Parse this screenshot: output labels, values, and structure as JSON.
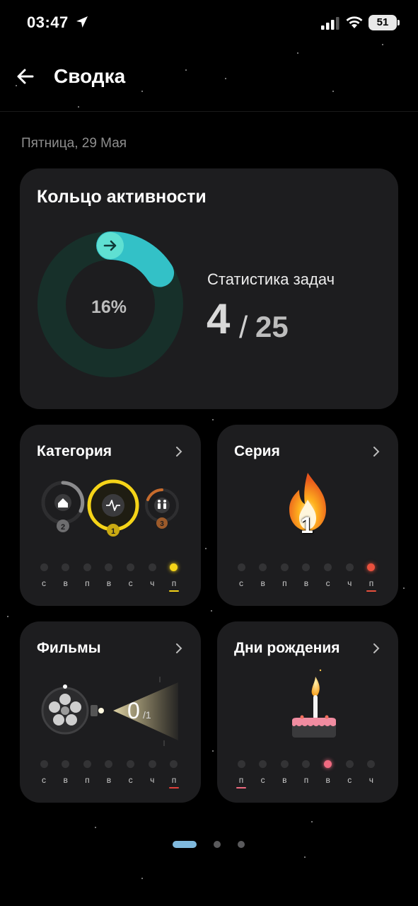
{
  "status_bar": {
    "time": "03:47",
    "battery": "51"
  },
  "header": {
    "title": "Сводка"
  },
  "date": "Пятница, 29 Мая",
  "activity": {
    "title": "Кольцо активности",
    "percent_label": "16%",
    "progress": 0.16,
    "stats_label": "Статистика задач",
    "done": "4",
    "slash": "/",
    "total": "25"
  },
  "categories": {
    "title": "Категория",
    "icons": [
      "home-icon",
      "pulse-icon",
      "family-icon"
    ],
    "ranks": [
      "2",
      "1",
      "3"
    ],
    "days": [
      "с",
      "в",
      "п",
      "в",
      "с",
      "ч",
      "п"
    ],
    "active_index": 6,
    "accent": "#f5d418"
  },
  "streak": {
    "title": "Серия",
    "count": "1",
    "days": [
      "с",
      "в",
      "п",
      "в",
      "с",
      "ч",
      "п"
    ],
    "active_index": 6,
    "accent": "#e8503d"
  },
  "movies": {
    "title": "Фильмы",
    "watched": "0",
    "total": "/1",
    "days": [
      "с",
      "в",
      "п",
      "в",
      "с",
      "ч",
      "п"
    ],
    "underline_index": 6,
    "accent": "#e0403a"
  },
  "birthdays": {
    "title": "Дни рождения",
    "days": [
      "п",
      "с",
      "в",
      "п",
      "в",
      "с",
      "ч"
    ],
    "active_index": 4,
    "underline_index": 0,
    "accent": "#f06a80"
  },
  "pager": {
    "pages": 3,
    "active": 0
  },
  "colors": {
    "background": "#000000",
    "card": "#1d1d1f",
    "ring_track": "#17302a",
    "ring_fill": "#33c1c7"
  }
}
